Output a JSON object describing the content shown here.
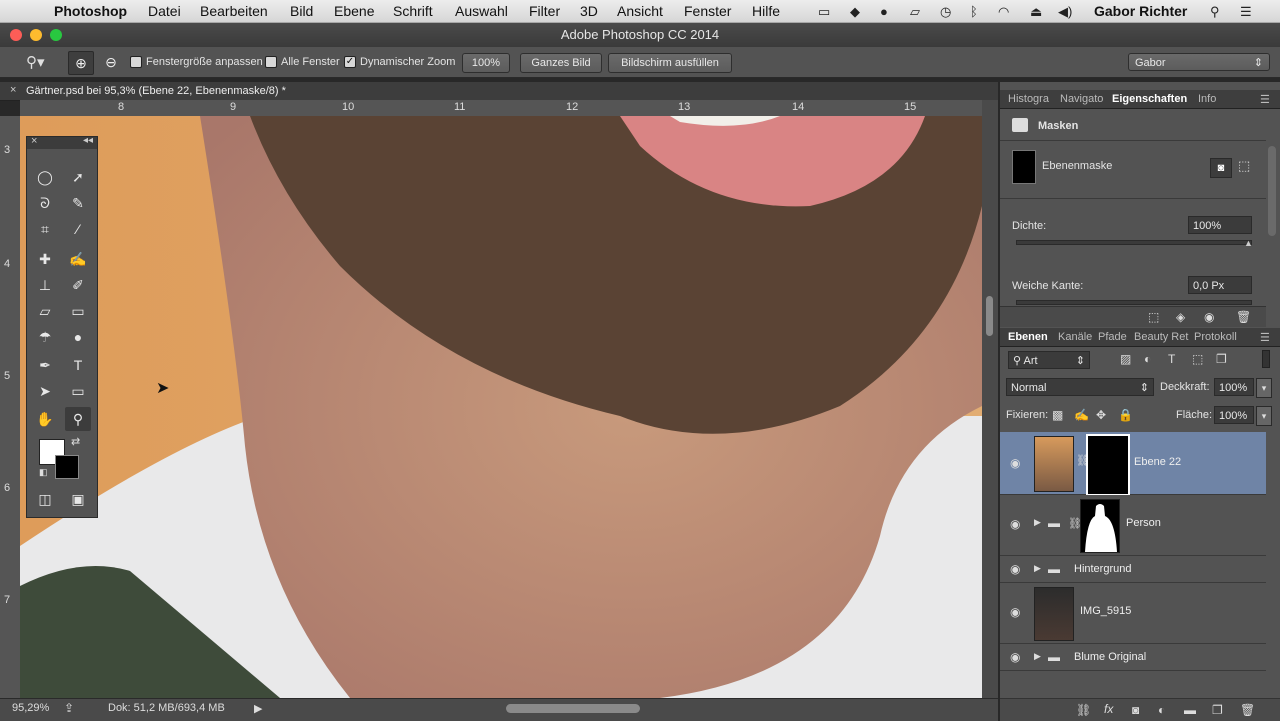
{
  "menubar": {
    "app": "Photoshop",
    "items": [
      "Datei",
      "Bearbeiten",
      "Bild",
      "Ebene",
      "Schrift",
      "Auswahl",
      "Filter",
      "3D",
      "Ansicht",
      "Fenster",
      "Hilfe"
    ],
    "user": "Gabor Richter"
  },
  "window": {
    "title": "Adobe Photoshop CC 2014"
  },
  "options": {
    "fit_window": "Fenstergröße anpassen",
    "all_windows": "Alle Fenster",
    "scrubby_zoom": "Dynamischer Zoom",
    "zoom_100": "100%",
    "fit_screen": "Ganzes Bild",
    "fill_screen": "Bildschirm ausfüllen",
    "workspace": "Gabor"
  },
  "document": {
    "tab_title": "Gärtner.psd bei 95,3% (Ebene 22, Ebenenmaske/8) *",
    "ruler_h": [
      "8",
      "9",
      "10",
      "11",
      "12",
      "13",
      "14",
      "15"
    ],
    "ruler_v": [
      "3",
      "4",
      "5",
      "6",
      "7"
    ]
  },
  "status": {
    "zoom": "95,29%",
    "doc": "Dok: 51,2 MB/693,4 MB"
  },
  "properties": {
    "tabs": [
      "Histogra",
      "Navigato",
      "Eigenschaften",
      "Info"
    ],
    "active_tab": "Eigenschaften",
    "section": "Masken",
    "mask_label": "Ebenenmaske",
    "density_label": "Dichte:",
    "density_value": "100%",
    "feather_label": "Weiche Kante:",
    "feather_value": "0,0 Px"
  },
  "layers": {
    "tabs": [
      "Ebenen",
      "Kanäle",
      "Pfade",
      "Beauty Ret",
      "Protokoll"
    ],
    "active_tab": "Ebenen",
    "filter_kind": "Art",
    "blend_mode": "Normal",
    "opacity_label": "Deckkraft:",
    "opacity_value": "100%",
    "lock_label": "Fixieren:",
    "fill_label": "Fläche:",
    "fill_value": "100%",
    "items": [
      {
        "name": "Ebene 22"
      },
      {
        "name": "Person"
      },
      {
        "name": "Hintergrund"
      },
      {
        "name": "IMG_5915"
      },
      {
        "name": "Blume Original"
      }
    ]
  }
}
